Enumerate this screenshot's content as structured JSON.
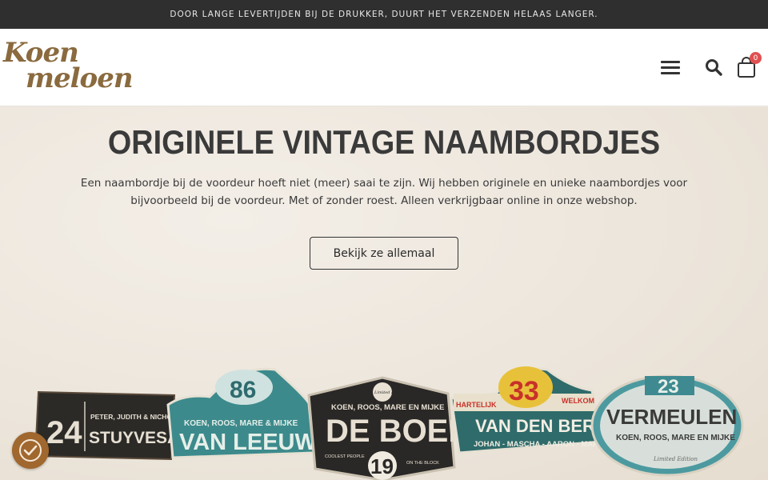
{
  "announcement": "DOOR LANGE LEVERTIJDEN BIJ DE DRUKKER, DUURT HET VERZENDEN HELAAS LANGER.",
  "logo": {
    "line1": "Koen",
    "line2": "meloen"
  },
  "header": {
    "cart_count": "0",
    "menu_icon": "menu-icon",
    "search_icon": "search-icon",
    "cart_icon": "cart-icon"
  },
  "hero": {
    "title": "ORIGINELE VINTAGE NAAMBORDJES",
    "text": "Een naambordje bij de voordeur hoeft niet (meer) saai te zijn. Wij hebben originele en unieke naambordjes voor bijvoorbeeld bij de voordeur. Met of zonder roest. Alleen verkrijgbaar online in onze webshop.",
    "button": "Bekijk ze allemaal"
  },
  "signs": [
    {
      "number": "24",
      "subtitle": "PETER, JUDITH & NICHOLAS",
      "name": "STUYVESANT"
    },
    {
      "number": "86",
      "subtitle": "KOEN, ROOS, MARE & MIJKE",
      "name": "VAN LEEUWEN"
    },
    {
      "top": "KOEN, ROOS, MARE EN MIJKE",
      "name": "DE BOER",
      "left_note": "COOLEST PEOPLE",
      "right_note": "ON THE BLOCK",
      "number": "19",
      "badge": "Limited Edition"
    },
    {
      "number": "33",
      "left_note": "HARTELIJK",
      "right_note": "WELKOM",
      "name": "VAN DEN BERG",
      "subtitle": "JOHAN - MASCHA - AARON - MARIA"
    },
    {
      "number": "23",
      "name": "VERMEULEN",
      "subtitle": "KOEN, ROOS, MARE EN MIJKE",
      "badge": "Limited Edition"
    }
  ],
  "accessibility": {
    "icon": "accessibility-icon"
  },
  "colors": {
    "topbar": "#2f2f2f",
    "brand": "#8a6a3e",
    "badge": "#e05050",
    "a11y": "#a0672f"
  }
}
